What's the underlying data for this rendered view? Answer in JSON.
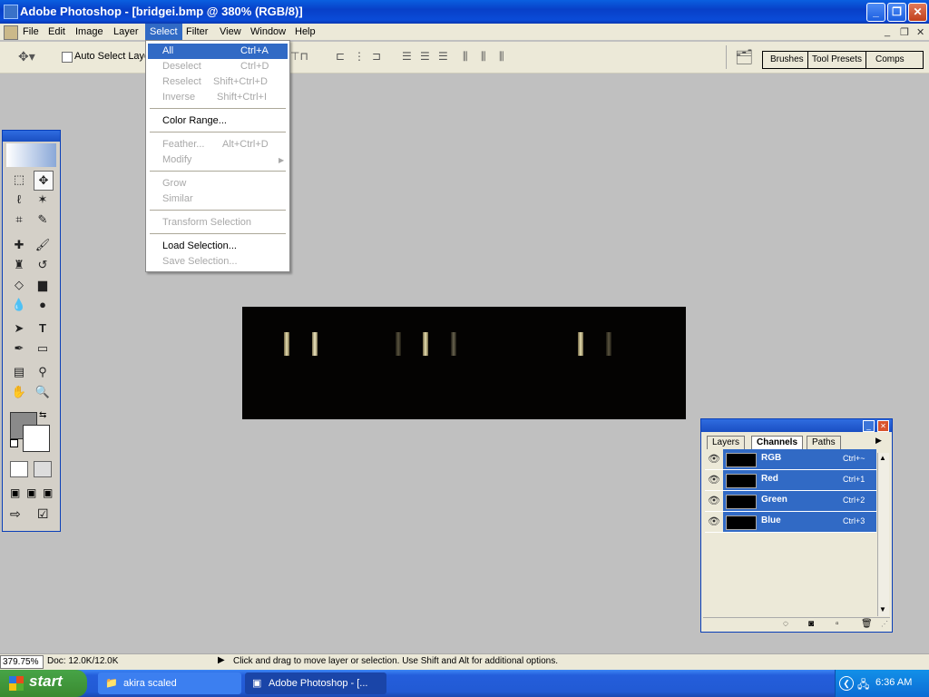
{
  "window": {
    "title": "Adobe Photoshop - [bridgei.bmp @ 380% (RGB/8)]",
    "controls": [
      "minimize",
      "restore",
      "close"
    ]
  },
  "menubar": {
    "items": [
      "File",
      "Edit",
      "Image",
      "Layer",
      "Select",
      "Filter",
      "View",
      "Window",
      "Help"
    ],
    "active": "Select"
  },
  "options_bar": {
    "auto_select_label": "Auto Select Layer",
    "well_tabs": [
      "Brushes",
      "Tool Presets",
      "Comps"
    ]
  },
  "select_menu": {
    "items": [
      {
        "label": "All",
        "shortcut": "Ctrl+A",
        "enabled": true,
        "highlighted": true
      },
      {
        "label": "Deselect",
        "shortcut": "Ctrl+D",
        "enabled": false
      },
      {
        "label": "Reselect",
        "shortcut": "Shift+Ctrl+D",
        "enabled": false
      },
      {
        "label": "Inverse",
        "shortcut": "Shift+Ctrl+I",
        "enabled": false
      },
      {
        "label": "Color Range...",
        "shortcut": "",
        "enabled": true
      },
      {
        "label": "Feather...",
        "shortcut": "Alt+Ctrl+D",
        "enabled": false
      },
      {
        "label": "Modify",
        "shortcut": "",
        "enabled": false,
        "submenu": true
      },
      {
        "label": "Grow",
        "shortcut": "",
        "enabled": false
      },
      {
        "label": "Similar",
        "shortcut": "",
        "enabled": false
      },
      {
        "label": "Transform Selection",
        "shortcut": "",
        "enabled": false
      },
      {
        "label": "Load Selection...",
        "shortcut": "",
        "enabled": true
      },
      {
        "label": "Save Selection...",
        "shortcut": "",
        "enabled": false
      }
    ]
  },
  "channels_panel": {
    "tabs": [
      "Layers",
      "Channels",
      "Paths"
    ],
    "active_tab": "Channels",
    "channels": [
      {
        "name": "RGB",
        "shortcut": "Ctrl+~"
      },
      {
        "name": "Red",
        "shortcut": "Ctrl+1"
      },
      {
        "name": "Green",
        "shortcut": "Ctrl+2"
      },
      {
        "name": "Blue",
        "shortcut": "Ctrl+3"
      }
    ]
  },
  "status_bar": {
    "zoom": "379.75%",
    "doc": "Doc: 12.0K/12.0K",
    "hint": "Click and drag to move layer or selection.  Use Shift and Alt for additional options."
  },
  "taskbar": {
    "start_label": "start",
    "tasks": [
      "akira scaled",
      "Adobe Photoshop - [..."
    ],
    "clock": "6:36 AM"
  },
  "colors": {
    "xp_blue": "#0a4bd8",
    "menu_highlight": "#316ac5",
    "canvas_bg": "#040302",
    "workspace": "#c0c0c0",
    "foreground_color": "#8a8a8a",
    "background_color": "#ffffff"
  }
}
